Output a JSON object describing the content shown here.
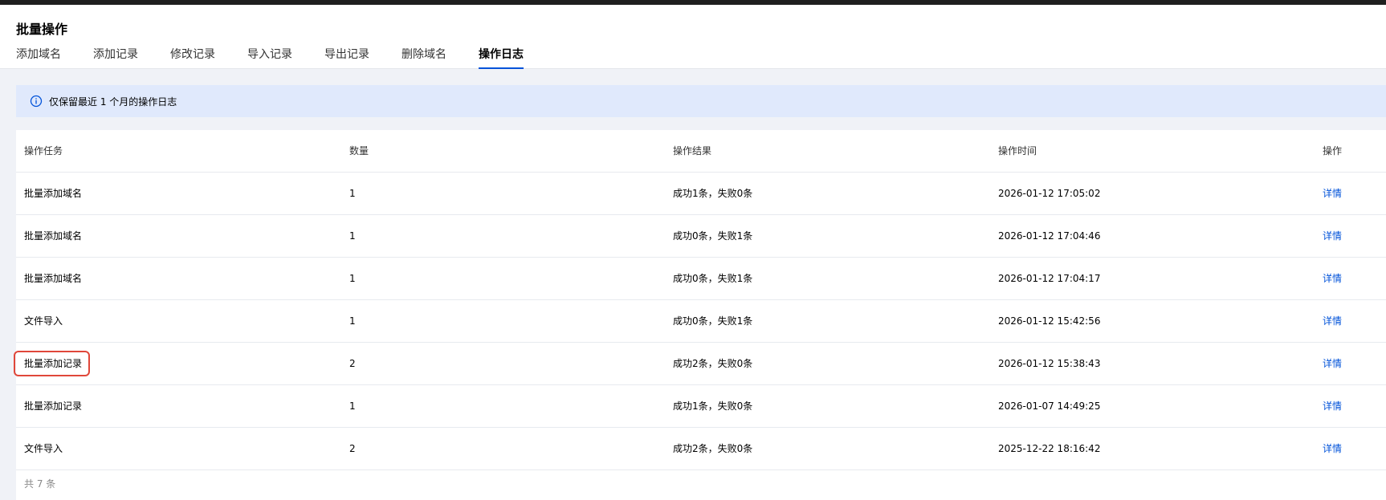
{
  "page": {
    "title": "批量操作"
  },
  "tabs": [
    {
      "label": "添加域名",
      "active": false
    },
    {
      "label": "添加记录",
      "active": false
    },
    {
      "label": "修改记录",
      "active": false
    },
    {
      "label": "导入记录",
      "active": false
    },
    {
      "label": "导出记录",
      "active": false
    },
    {
      "label": "删除域名",
      "active": false
    },
    {
      "label": "操作日志",
      "active": true
    }
  ],
  "notice": {
    "icon": "info-icon",
    "text": "仅保留最近 1 个月的操作日志"
  },
  "table": {
    "headers": [
      "操作任务",
      "数量",
      "操作结果",
      "操作时间",
      "操作"
    ],
    "rows": [
      {
        "task": "批量添加域名",
        "count": "1",
        "result": "成功1条，失败0条",
        "time": "2026-01-12 17:05:02",
        "action": "详情"
      },
      {
        "task": "批量添加域名",
        "count": "1",
        "result": "成功0条，失败1条",
        "time": "2026-01-12 17:04:46",
        "action": "详情"
      },
      {
        "task": "批量添加域名",
        "count": "1",
        "result": "成功0条，失败1条",
        "time": "2026-01-12 17:04:17",
        "action": "详情"
      },
      {
        "task": "文件导入",
        "count": "1",
        "result": "成功0条，失败1条",
        "time": "2026-01-12 15:42:56",
        "action": "详情"
      },
      {
        "task": "批量添加记录",
        "count": "2",
        "result": "成功2条，失败0条",
        "time": "2026-01-12 15:38:43",
        "action": "详情"
      },
      {
        "task": "批量添加记录",
        "count": "1",
        "result": "成功1条，失败0条",
        "time": "2026-01-07 14:49:25",
        "action": "详情"
      },
      {
        "task": "文件导入",
        "count": "2",
        "result": "成功2条，失败0条",
        "time": "2025-12-22 18:16:42",
        "action": "详情"
      }
    ],
    "total": "共 7 条"
  },
  "colors": {
    "accent": "#0052d9",
    "notice_bg": "#e0e9fc",
    "highlight": "#e0473a"
  }
}
